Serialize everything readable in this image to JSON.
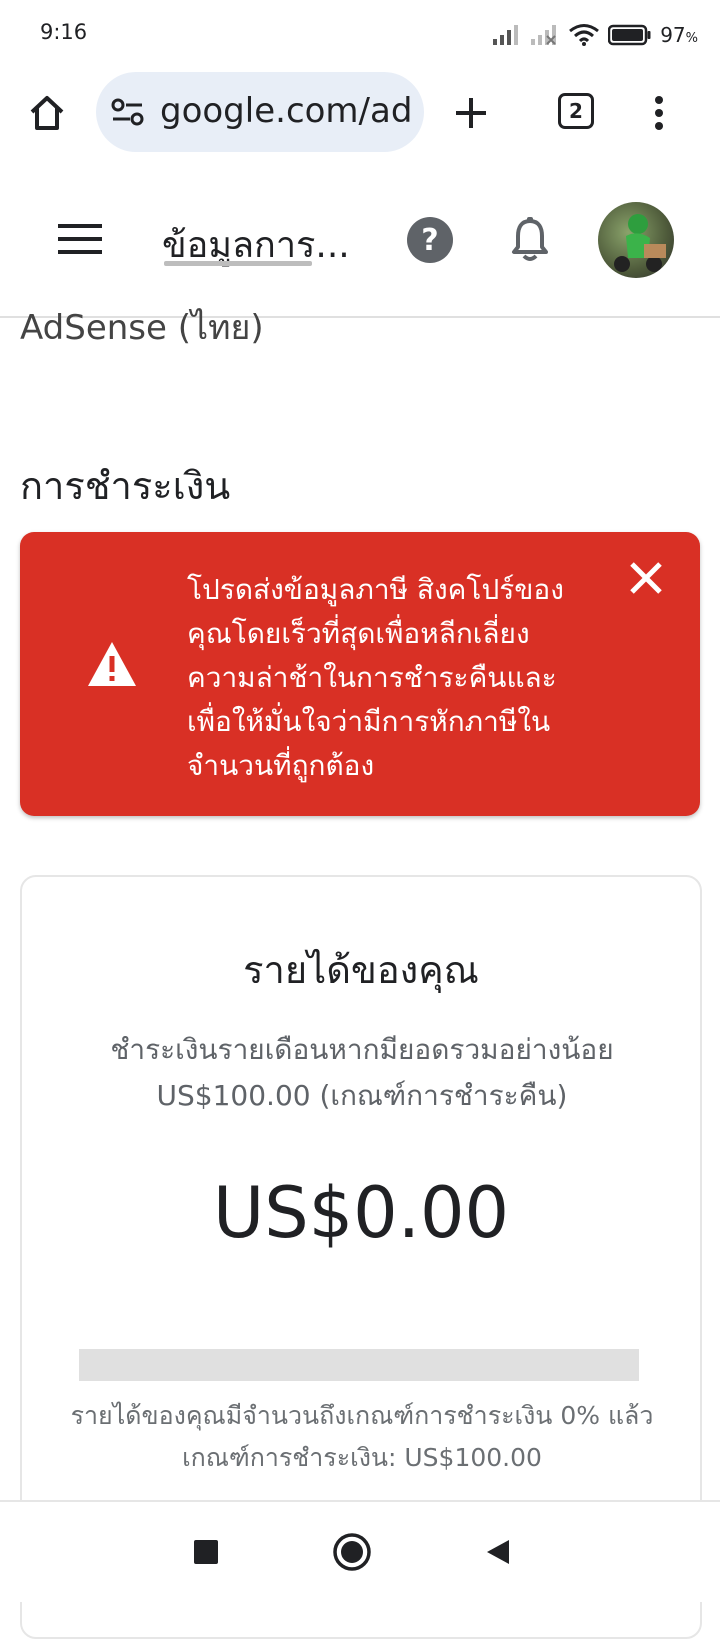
{
  "status_bar": {
    "time": "9:16",
    "battery": "97",
    "battery_unit": "%",
    "icons": [
      "signal-icon",
      "signal-no-service-icon",
      "wifi-icon",
      "battery-icon"
    ]
  },
  "browser": {
    "url": "google.com/ad",
    "tab_count": "2",
    "icons": [
      "home-icon",
      "site-settings-icon",
      "new-tab-icon",
      "tab-switcher-icon",
      "more-vert-icon"
    ]
  },
  "app_header": {
    "title": "ข้อมูลการ...",
    "icons": [
      "menu-icon",
      "help-icon",
      "notification-bell-icon",
      "avatar"
    ]
  },
  "partial_text": "AdSense (ไทย)",
  "section": {
    "heading": "การชำระเงิน"
  },
  "alert": {
    "message": "โปรดส่งข้อมูลภาษี สิงคโปร์ของคุณโดยเร็วที่สุดเพื่อหลีกเลี่ยงความล่าช้าในการชำระคืนและเพื่อให้มั่นใจว่ามีการหักภาษีในจำนวนที่ถูกต้อง",
    "color": "#d93025",
    "icons": [
      "warning-icon",
      "close-icon"
    ]
  },
  "earnings": {
    "title": "รายได้ของคุณ",
    "description": "ชำระเงินรายเดือนหากมียอดรวมอย่างน้อย US$100.00 (เกณฑ์การชำระคืน)",
    "amount": "US$0.00",
    "progress_percent": 0,
    "progress_line1": "รายได้ของคุณมีจำนวนถึงเกณฑ์การชำระเงิน 0% แล้ว",
    "progress_line2": "เกณฑ์การชำระเงิน: US$100.00"
  },
  "nav_bar": {
    "icons": [
      "recents-square-icon",
      "home-circle-icon",
      "back-triangle-icon"
    ]
  }
}
